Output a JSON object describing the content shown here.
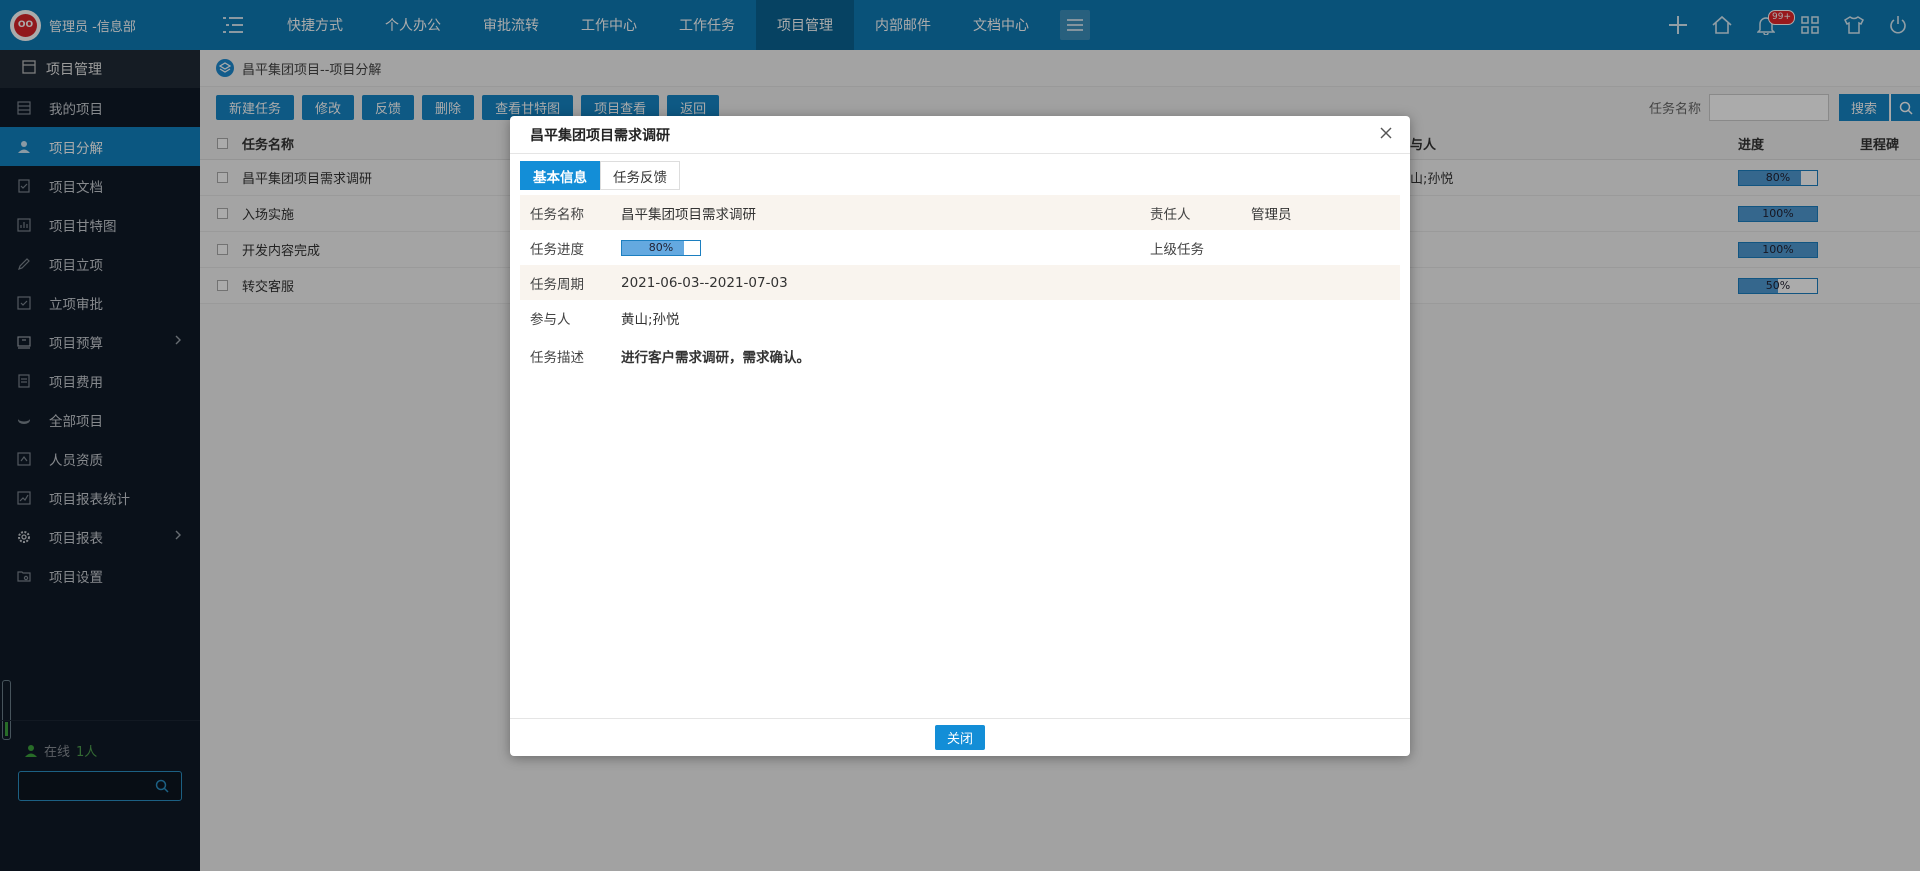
{
  "header": {
    "logo_text": "OO",
    "user": "管理员 -信息部",
    "nav": [
      "快捷方式",
      "个人办公",
      "审批流转",
      "工作中心",
      "工作任务",
      "项目管理",
      "内部邮件",
      "文档中心"
    ],
    "active_nav": "项目管理",
    "notification_badge": "99+",
    "icons": [
      "plus-icon",
      "home-icon",
      "bell-icon",
      "apps-icon",
      "shirt-icon",
      "power-icon"
    ]
  },
  "sidebar": {
    "section": "项目管理",
    "items": [
      {
        "label": "我的项目",
        "icon": "grid-icon"
      },
      {
        "label": "项目分解",
        "icon": "person-icon",
        "active": true
      },
      {
        "label": "项目文档",
        "icon": "doc-icon"
      },
      {
        "label": "项目甘特图",
        "icon": "chart-icon"
      },
      {
        "label": "项目立项",
        "icon": "pencil-icon"
      },
      {
        "label": "立项审批",
        "icon": "check-icon"
      },
      {
        "label": "项目预算",
        "icon": "budget-icon",
        "has_submenu": true
      },
      {
        "label": "项目费用",
        "icon": "receipt-icon"
      },
      {
        "label": "全部项目",
        "icon": "layers-icon"
      },
      {
        "label": "人员资质",
        "icon": "badge-icon"
      },
      {
        "label": "项目报表统计",
        "icon": "stats-icon"
      },
      {
        "label": "项目报表",
        "icon": "gear-icon",
        "has_submenu": true
      },
      {
        "label": "项目设置",
        "icon": "folder-settings-icon"
      }
    ],
    "online_label": "在线",
    "online_count": "1人"
  },
  "breadcrumb": "昌平集团项目--项目分解",
  "toolbar": {
    "buttons": [
      "新建任务",
      "修改",
      "反馈",
      "删除",
      "查看甘特图",
      "项目查看",
      "返回"
    ],
    "search_label": "任务名称",
    "search_button": "搜索"
  },
  "grid": {
    "columns": {
      "name": "任务名称",
      "owner": "与人",
      "progress": "进度",
      "milestone": "里程碑"
    },
    "rows": [
      {
        "name": "昌平集团项目需求调研",
        "owner": "山;孙悦",
        "progress": 80,
        "progress_text": "80%"
      },
      {
        "name": "入场实施",
        "owner": "",
        "progress": 100,
        "progress_text": "100%"
      },
      {
        "name": "开发内容完成",
        "owner": "",
        "progress": 100,
        "progress_text": "100%"
      },
      {
        "name": "转交客服",
        "owner": "",
        "progress": 50,
        "progress_text": "50%"
      }
    ]
  },
  "modal": {
    "title": "昌平集团项目需求调研",
    "tabs": [
      "基本信息",
      "任务反馈"
    ],
    "active_tab": "基本信息",
    "fields": {
      "task_name_label": "任务名称",
      "task_name": "昌平集团项目需求调研",
      "owner_label": "责任人",
      "owner": "管理员",
      "progress_label": "任务进度",
      "progress": 80,
      "progress_text": "80%",
      "parent_label": "上级任务",
      "parent": "",
      "period_label": "任务周期",
      "period": "2021-06-03--2021-07-03",
      "participants_label": "参与人",
      "participants": "黄山;孙悦",
      "desc_label": "任务描述",
      "desc": "进行客户需求调研，需求确认。"
    },
    "close_button": "关闭"
  }
}
